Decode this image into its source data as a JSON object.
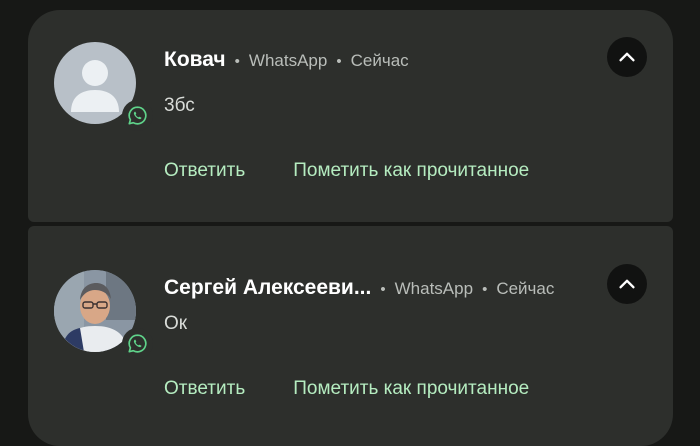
{
  "notifications": [
    {
      "sender": "Ковач",
      "app": "WhatsApp",
      "time": "Сейчас",
      "message": "3бс",
      "reply_label": "Ответить",
      "mark_read_label": "Пометить как прочитанное",
      "avatar_icon": "default-person-avatar",
      "badge_icon": "whatsapp-icon",
      "collapse_icon": "chevron-up-icon"
    },
    {
      "sender": "Сергей Алексееви...",
      "app": "WhatsApp",
      "time": "Сейчас",
      "message": "Ок",
      "reply_label": "Ответить",
      "mark_read_label": "Пометить как прочитанное",
      "avatar_icon": "contact-photo",
      "badge_icon": "whatsapp-icon",
      "collapse_icon": "chevron-up-icon"
    }
  ],
  "separator": "•",
  "colors": {
    "background": "#171816",
    "card": "#2d2f2c",
    "action_text": "#b5ecc0",
    "whatsapp_green": "#5fd38a"
  }
}
